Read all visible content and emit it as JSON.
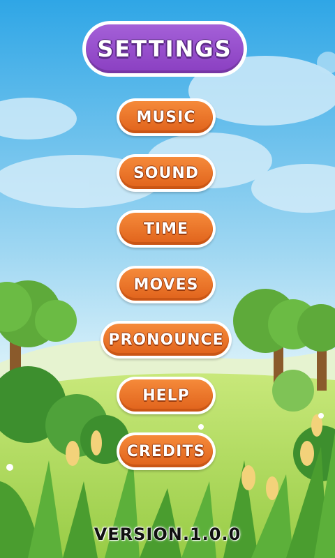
{
  "title": "SETTINGS",
  "buttons": [
    {
      "label": "MUSIC"
    },
    {
      "label": "SOUND"
    },
    {
      "label": "TIME"
    },
    {
      "label": "MOVES"
    },
    {
      "label": "PRONOUNCE"
    },
    {
      "label": "HELP"
    },
    {
      "label": "CREDITS"
    }
  ],
  "version": "VERSION.1.0.0",
  "colors": {
    "title_purple": "#9b4fd0",
    "button_orange": "#ee7428",
    "sky_top": "#2fa6e6",
    "grass": "#8cc63e"
  }
}
